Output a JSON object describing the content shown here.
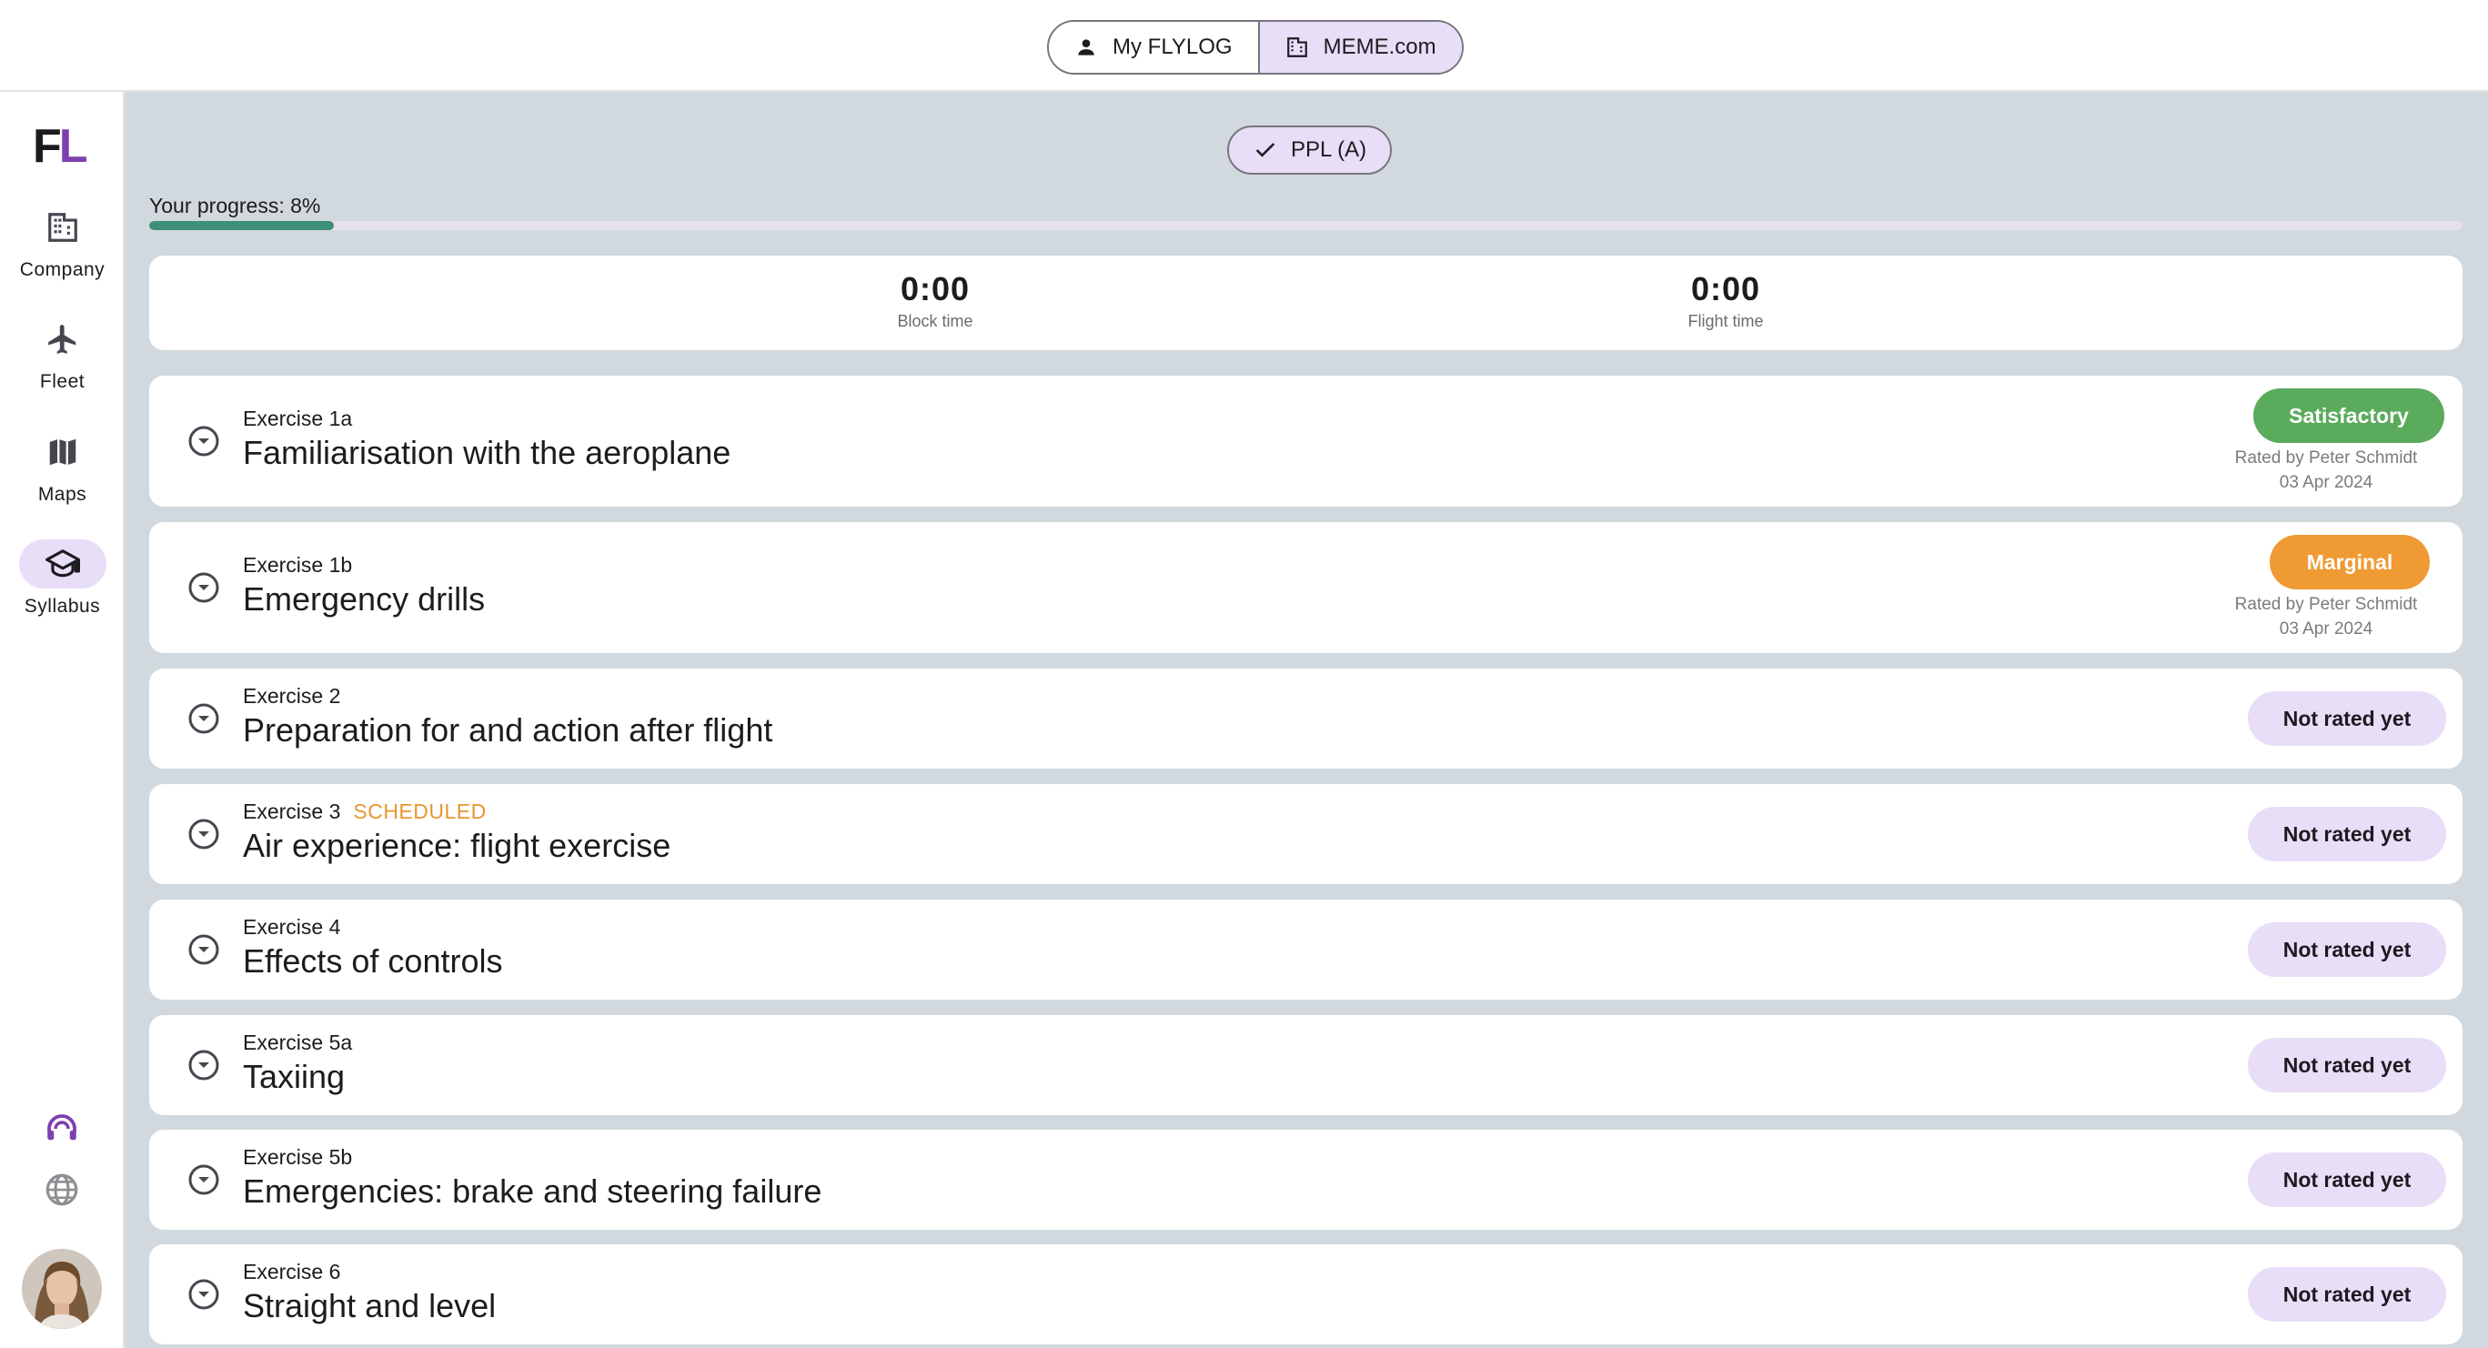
{
  "header": {
    "my_flylog_label": "My FLYLOG",
    "company_label": "MEME.com"
  },
  "sidebar": {
    "logo_f": "F",
    "logo_l": "L",
    "items": [
      {
        "label": "Company",
        "icon": "company-icon"
      },
      {
        "label": "Fleet",
        "icon": "plane-icon"
      },
      {
        "label": "Maps",
        "icon": "map-icon"
      },
      {
        "label": "Syllabus",
        "icon": "graduation-cap-icon",
        "active": true
      }
    ],
    "bottom_icons": [
      "support-headset-icon",
      "globe-icon"
    ]
  },
  "main": {
    "course_chip": "PPL (A)",
    "progress_label": "Your progress: 8%",
    "progress_value": 0.08,
    "stats": [
      {
        "value": "0:00",
        "label": "Block time"
      },
      {
        "value": "0:00",
        "label": "Flight time"
      }
    ],
    "exercises": [
      {
        "code": "Exercise 1a",
        "title": "Familiarisation with the aeroplane",
        "status": "Satisfactory",
        "rated_by": "Rated by Peter Schmidt",
        "date": "03 Apr 2024",
        "scheduled": ""
      },
      {
        "code": "Exercise 1b",
        "title": "Emergency drills",
        "status": "Marginal",
        "rated_by": "Rated by Peter Schmidt",
        "date": "03 Apr 2024",
        "scheduled": ""
      },
      {
        "code": "Exercise 2",
        "title": "Preparation for and action after flight",
        "status": "Not rated yet",
        "scheduled": ""
      },
      {
        "code": "Exercise 3",
        "title": "Air experience: flight exercise",
        "status": "Not rated yet",
        "scheduled": "SCHEDULED"
      },
      {
        "code": "Exercise 4",
        "title": "Effects of controls",
        "status": "Not rated yet",
        "scheduled": ""
      },
      {
        "code": "Exercise 5a",
        "title": "Taxiing",
        "status": "Not rated yet",
        "scheduled": ""
      },
      {
        "code": "Exercise 5b",
        "title": "Emergencies: brake and steering failure",
        "status": "Not rated yet",
        "scheduled": ""
      },
      {
        "code": "Exercise 6",
        "title": "Straight and level",
        "status": "Not rated yet",
        "scheduled": ""
      }
    ]
  },
  "colors": {
    "brand_purple": "#7e3fb0",
    "satisfactory": "#5aab5c",
    "marginal": "#ef9a33",
    "not_rated": "#e8def8",
    "progress": "#3e8f77",
    "scheduled": "#e8962e"
  }
}
